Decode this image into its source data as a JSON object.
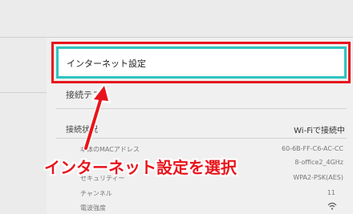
{
  "settings": {
    "internet_settings_label": "インターネット設定",
    "connection_test_label": "接続テスト",
    "connection_status": {
      "label": "接続状況",
      "value": "Wi-Fiで接続中",
      "details": [
        {
          "label": "本体のMACアドレス",
          "value": "60-6B-FF-C6-AC-CC"
        },
        {
          "label": "",
          "value": "8-office2_4GHz"
        },
        {
          "label": "セキュリティー",
          "value": "WPA2-PSK(AES)"
        },
        {
          "label": "チャンネル",
          "value": "11"
        },
        {
          "label": "電波強度",
          "value": ""
        }
      ]
    }
  },
  "annotation": {
    "callout_text": "インターネット設定を選択",
    "color": "#e8141c"
  },
  "colors": {
    "selection_border": "#2ec4c0",
    "highlight": "#e8141c"
  },
  "icons": {
    "signal": "wifi-icon"
  }
}
